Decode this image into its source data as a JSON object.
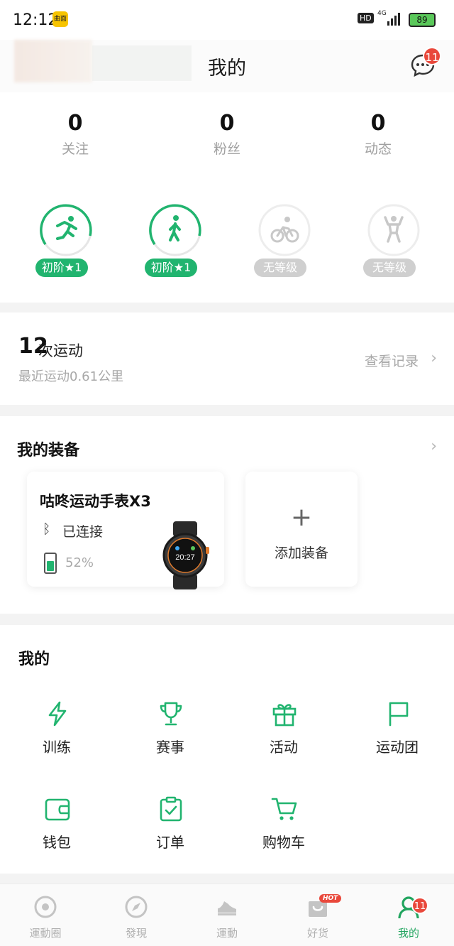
{
  "status_bar": {
    "time": "12:12",
    "app_icon": "曲面",
    "hd": "HD",
    "network": "4G",
    "battery": "89"
  },
  "header": {
    "title": "我的",
    "message_badge": "11",
    "message_icon": "chat-bubble-icon"
  },
  "stats": [
    {
      "value": "0",
      "label": "关注"
    },
    {
      "value": "0",
      "label": "粉丝"
    },
    {
      "value": "0",
      "label": "动态"
    }
  ],
  "levels": [
    {
      "icon": "running-icon",
      "tag": "初阶★1",
      "active": true,
      "progress": 0.6
    },
    {
      "icon": "walking-icon",
      "tag": "初阶★1",
      "active": true,
      "progress": 0.6
    },
    {
      "icon": "cycling-icon",
      "tag": "无等级",
      "active": false,
      "progress": 0
    },
    {
      "icon": "fitness-icon",
      "tag": "无等级",
      "active": false,
      "progress": 0
    }
  ],
  "records": {
    "count": "12",
    "count_label": "次运动",
    "subtitle": "最近运动0.61公里",
    "link": "查看记录"
  },
  "equipment": {
    "title": "我的装备",
    "device": {
      "name": "咕咚运动手表X3",
      "status": "已连接",
      "battery": "52%",
      "battery_level": 0.52,
      "watch_time": "20:27"
    },
    "add_label": "添加装备"
  },
  "mine": {
    "title": "我的",
    "items": [
      {
        "label": "训练",
        "icon": "lightning-icon"
      },
      {
        "label": "赛事",
        "icon": "trophy-icon"
      },
      {
        "label": "活动",
        "icon": "gift-icon"
      },
      {
        "label": "运动团",
        "icon": "flag-icon"
      },
      {
        "label": "钱包",
        "icon": "wallet-icon"
      },
      {
        "label": "订单",
        "icon": "clipboard-check-icon"
      },
      {
        "label": "购物车",
        "icon": "cart-icon"
      }
    ]
  },
  "tabbar": {
    "tabs": [
      {
        "label": "運動圈",
        "icon": "circle-target-icon"
      },
      {
        "label": "發現",
        "icon": "compass-icon"
      },
      {
        "label": "運動",
        "icon": "shoe-icon"
      },
      {
        "label": "好货",
        "icon": "shop-bag-icon",
        "badge": "HOT"
      },
      {
        "label": "我的",
        "icon": "person-icon",
        "badge": "11",
        "active": true
      }
    ]
  },
  "colors": {
    "accent": "#21b46f",
    "badge": "#e9483b",
    "muted": "#a8a8a8"
  }
}
